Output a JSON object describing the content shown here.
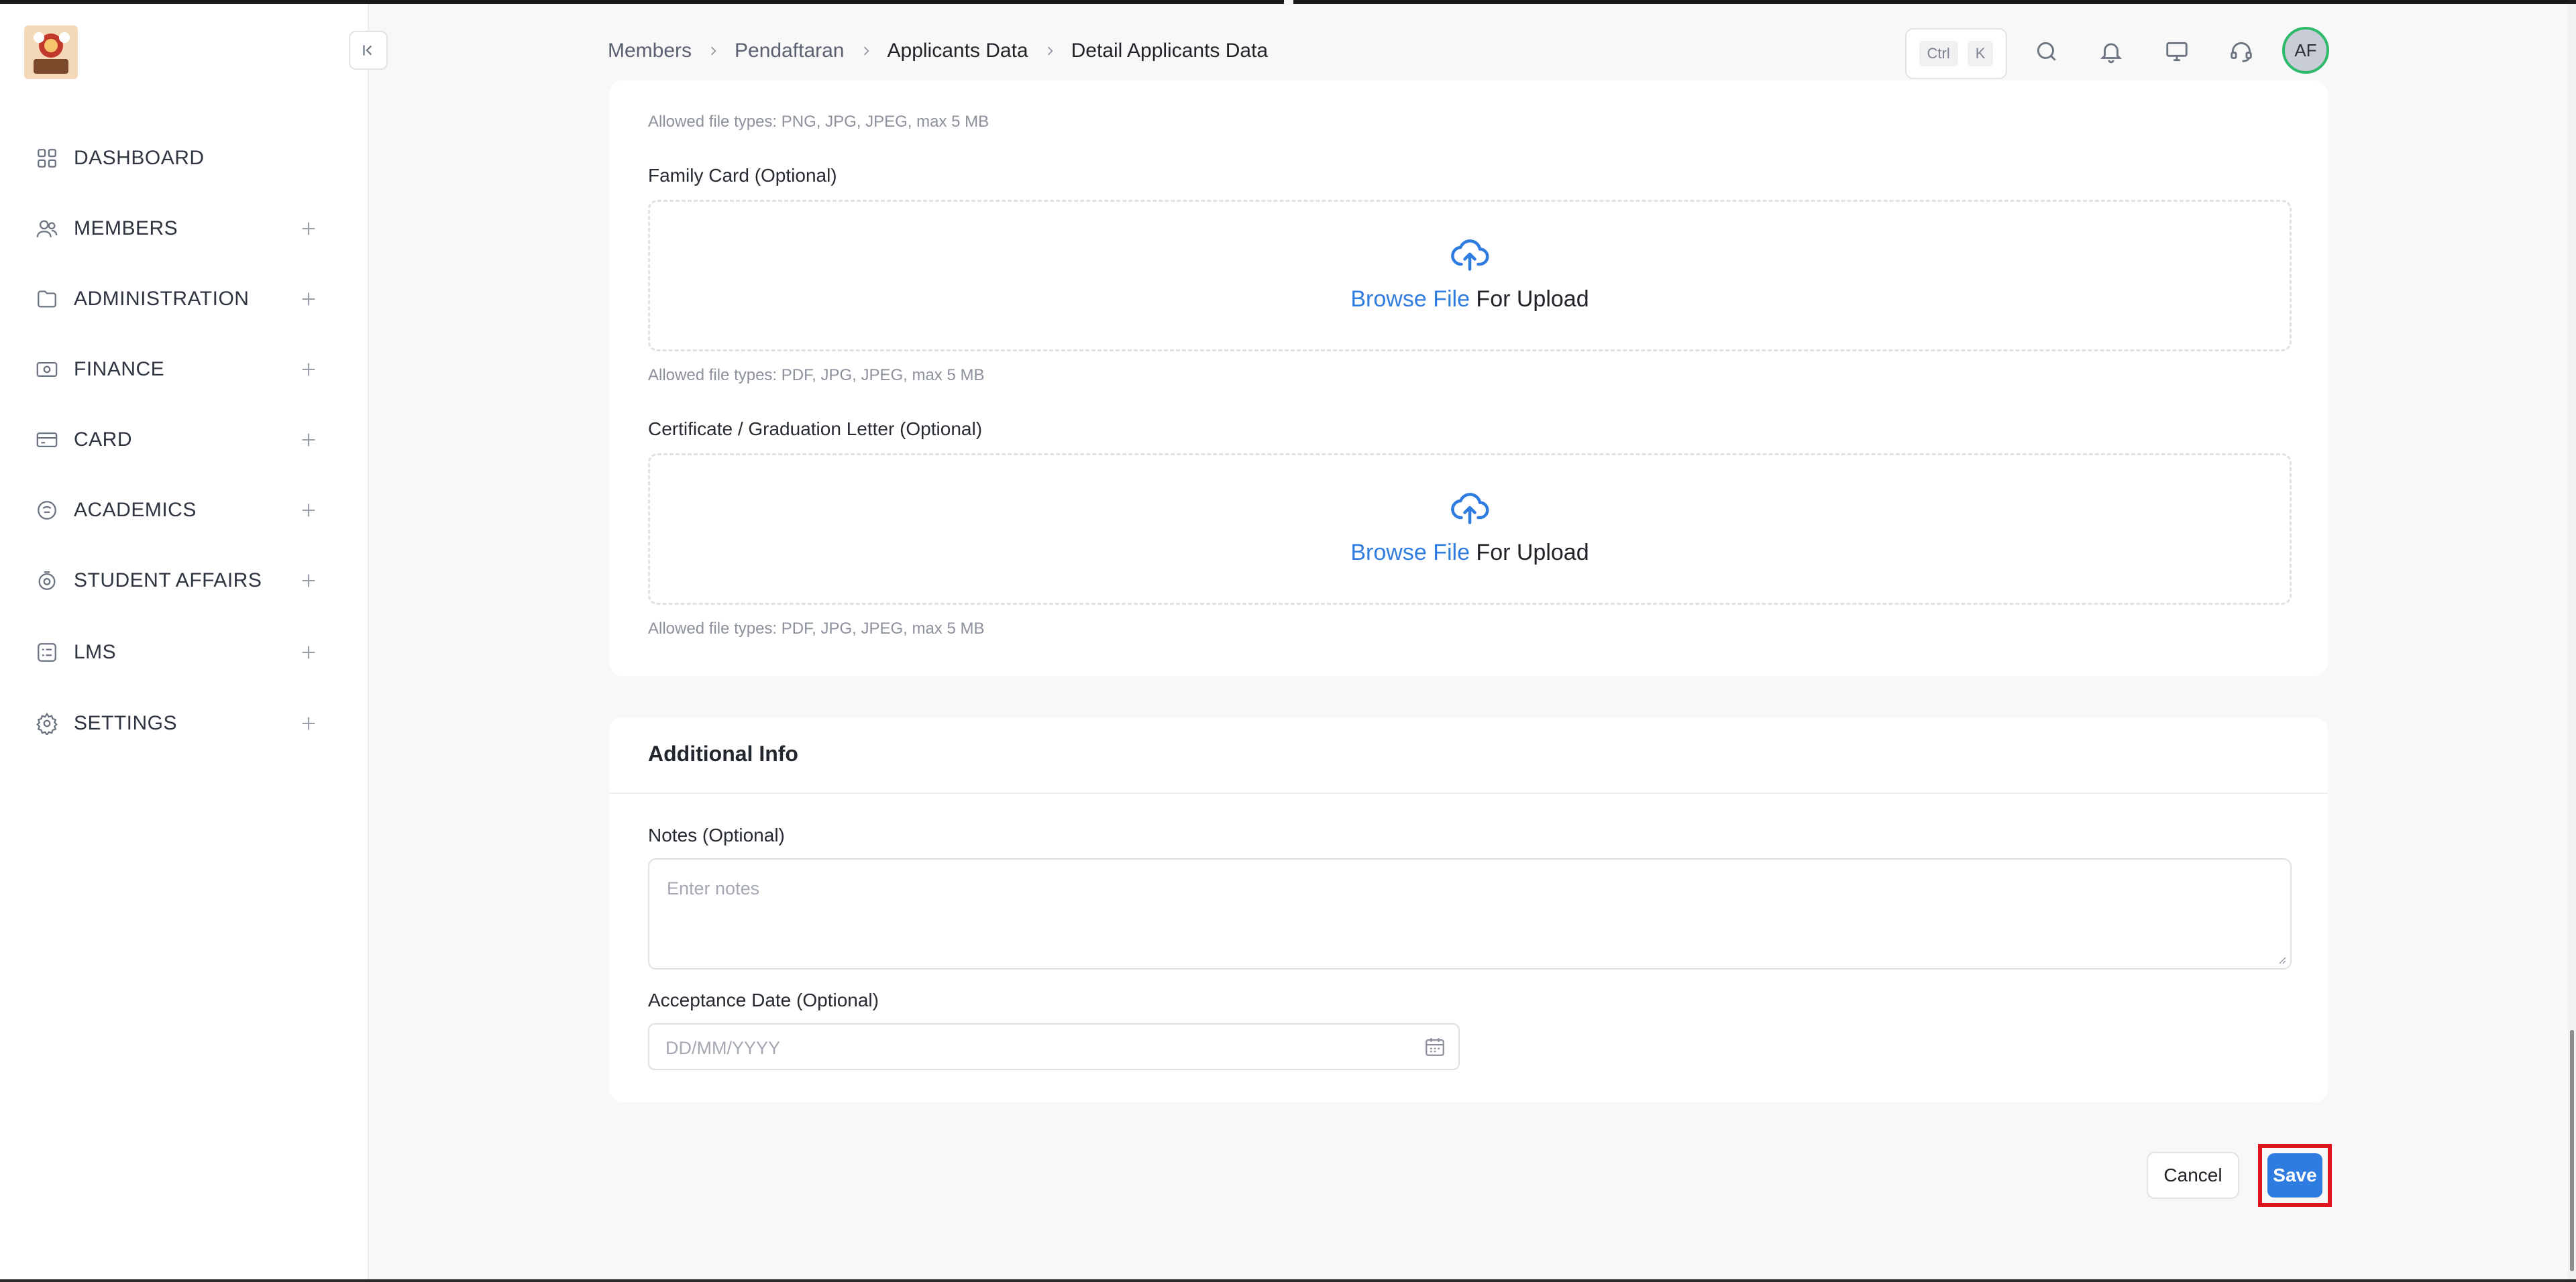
{
  "colors": {
    "accent": "#2f7ce0",
    "avatar_ring": "#2fb96b",
    "highlight": "#e0141e"
  },
  "sidebar": {
    "items": [
      {
        "label": "DASHBOARD",
        "icon": "grid-icon",
        "expandable": false
      },
      {
        "label": "MEMBERS",
        "icon": "users-icon",
        "expandable": true
      },
      {
        "label": "ADMINISTRATION",
        "icon": "folder-icon",
        "expandable": true
      },
      {
        "label": "FINANCE",
        "icon": "cash-icon",
        "expandable": true
      },
      {
        "label": "CARD",
        "icon": "credit-card-icon",
        "expandable": true
      },
      {
        "label": "ACADEMICS",
        "icon": "academics-icon",
        "expandable": true
      },
      {
        "label": "STUDENT AFFAIRS",
        "icon": "badge-icon",
        "expandable": true
      },
      {
        "label": "LMS",
        "icon": "checklist-icon",
        "expandable": true
      },
      {
        "label": "SETTINGS",
        "icon": "gear-icon",
        "expandable": true
      }
    ]
  },
  "header": {
    "breadcrumb": [
      "Members",
      "Pendaftaran",
      "Applicants Data",
      "Detail Applicants Data"
    ],
    "shortcut": {
      "mod": "Ctrl",
      "key": "K"
    },
    "avatar_initials": "AF"
  },
  "uploads": {
    "top_hint": "Allowed file types: PNG, JPG, JPEG, max 5 MB",
    "family_card": {
      "label": "Family Card (Optional)",
      "browse": "Browse File",
      "suffix": " For Upload",
      "hint": "Allowed file types: PDF, JPG, JPEG, max 5 MB"
    },
    "certificate": {
      "label": "Certificate / Graduation Letter (Optional)",
      "browse": "Browse File",
      "suffix": " For Upload",
      "hint": "Allowed file types: PDF, JPG, JPEG, max 5 MB"
    }
  },
  "additional": {
    "title": "Additional Info",
    "notes_label": "Notes (Optional)",
    "notes_placeholder": "Enter notes",
    "date_label": "Acceptance Date (Optional)",
    "date_placeholder": "DD/MM/YYYY"
  },
  "actions": {
    "cancel": "Cancel",
    "save": "Save"
  }
}
